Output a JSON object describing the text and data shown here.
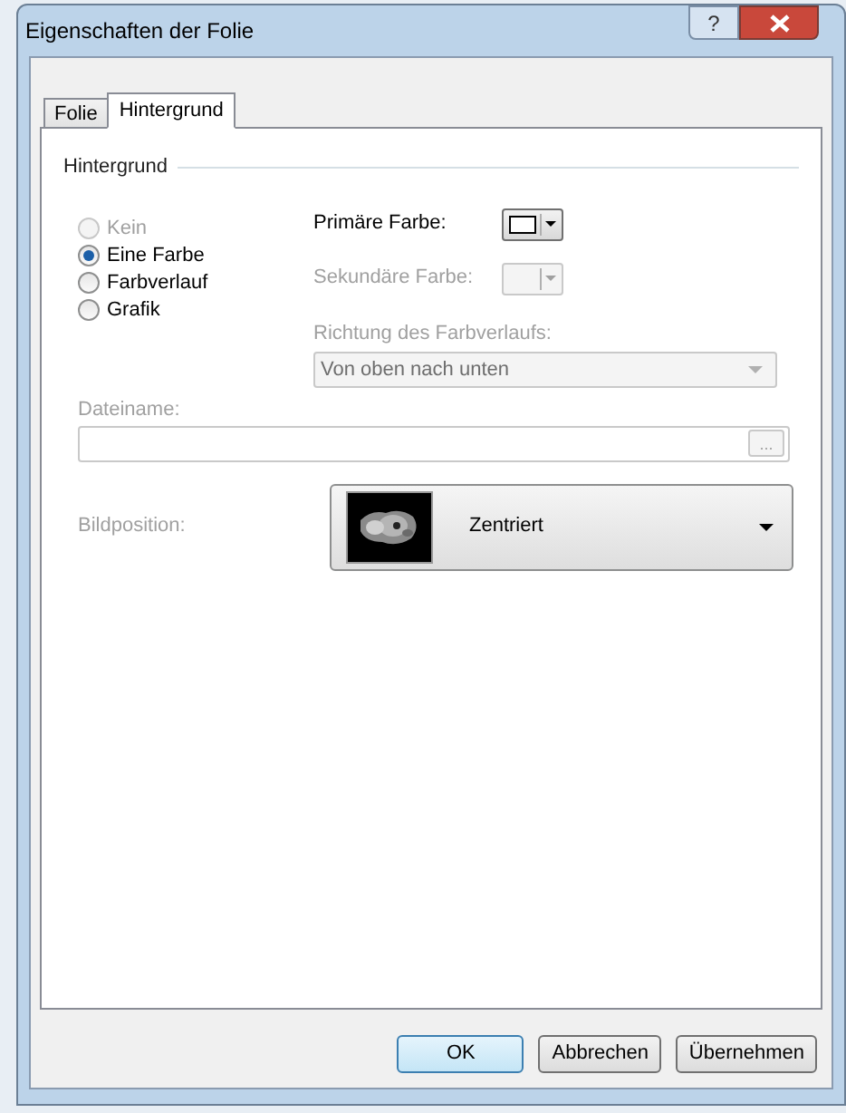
{
  "window": {
    "title": "Eigenschaften der Folie",
    "help_button": "?"
  },
  "tabs": [
    {
      "label": "Folie",
      "selected": false
    },
    {
      "label": "Hintergrund",
      "selected": true
    }
  ],
  "group": {
    "title": "Hintergrund"
  },
  "fill_options": [
    {
      "label": "Kein",
      "selected": false,
      "disabled": true
    },
    {
      "label": "Eine Farbe",
      "selected": true,
      "disabled": false
    },
    {
      "label": "Farbverlauf",
      "selected": false,
      "disabled": false
    },
    {
      "label": "Grafik",
      "selected": false,
      "disabled": false
    }
  ],
  "primary_color": {
    "label": "Primäre Farbe:",
    "disabled": false
  },
  "secondary_color": {
    "label": "Sekundäre Farbe:",
    "disabled": true
  },
  "gradient_direction": {
    "label": "Richtung des Farbverlaufs:",
    "value": "Von oben nach unten",
    "disabled": true
  },
  "filename": {
    "label": "Dateiname:",
    "browse_button": "...",
    "disabled": true
  },
  "image_position": {
    "label": "Bildposition:",
    "value": "Zentriert",
    "label_disabled": true
  },
  "buttons": [
    {
      "label": "OK",
      "default": true
    },
    {
      "label": "Abbrechen",
      "default": false
    },
    {
      "label": "Übernehmen",
      "default": false
    }
  ]
}
